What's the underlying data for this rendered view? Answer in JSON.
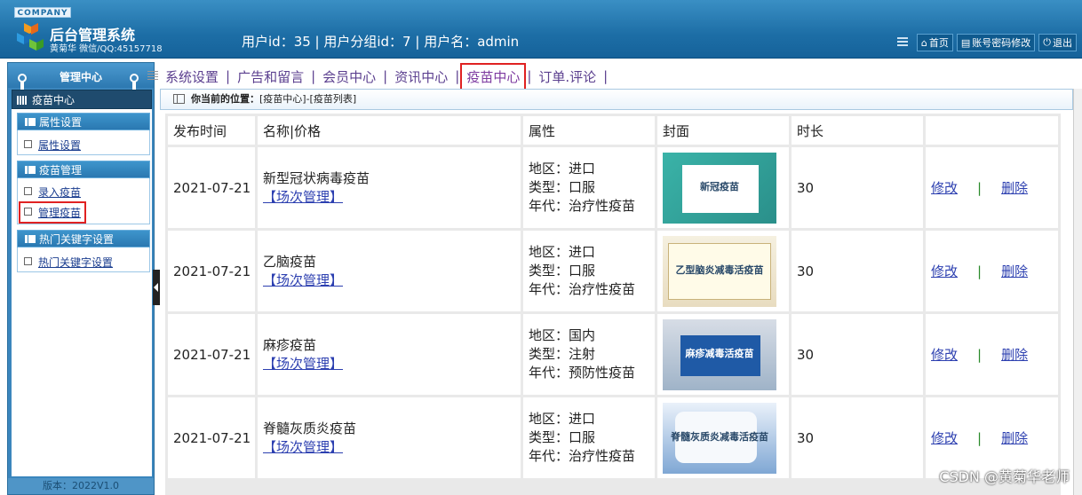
{
  "header": {
    "company": "COMPANY",
    "title": "后台管理系统",
    "subtitle": "黄菊华 微信/QQ:45157718",
    "user_info": "用户id：35 | 用户分组id：7 | 用户名：admin",
    "links": [
      "首页",
      "账号密码修改",
      "退出"
    ]
  },
  "sidebar": {
    "title": "管理中心",
    "current": "疫苗中心",
    "groups": [
      {
        "label": "属性设置",
        "items": [
          "属性设置"
        ]
      },
      {
        "label": "疫苗管理",
        "items": [
          "录入疫苗",
          "管理疫苗"
        ]
      },
      {
        "label": "热门关键字设置",
        "items": [
          "热门关键字设置"
        ]
      }
    ],
    "footer": "版本：2022V1.0"
  },
  "nav": {
    "items": [
      "系统设置",
      "广告和留言",
      "会员中心",
      "资讯中心",
      "疫苗中心",
      "订单.评论"
    ],
    "separator": "|",
    "active": "疫苗中心"
  },
  "breadcrumb": {
    "label": "你当前的位置：",
    "path": "[疫苗中心]-[疫苗列表]"
  },
  "table": {
    "columns": [
      "发布时间",
      "名称|价格",
      "属性",
      "封面",
      "时长",
      ""
    ],
    "attr_labels": [
      "地区：",
      "类型：",
      "年代："
    ],
    "sub_link": "【场次管理】",
    "edit_label": "修改",
    "delete_label": "删除",
    "divider": "|",
    "rows": [
      {
        "date": "2021-07-21",
        "name": "新型冠状病毒疫苗",
        "region": "进口",
        "type": "口服",
        "era": "治疗性疫苗",
        "cover_text": "新冠疫苗",
        "duration": "30"
      },
      {
        "date": "2021-07-21",
        "name": "乙脑疫苗",
        "region": "进口",
        "type": "口服",
        "era": "治疗性疫苗",
        "cover_text": "乙型脑炎减毒活疫苗",
        "duration": "30"
      },
      {
        "date": "2021-07-21",
        "name": "麻疹疫苗",
        "region": "国内",
        "type": "注射",
        "era": "预防性疫苗",
        "cover_text": "麻疹减毒活疫苗",
        "duration": "30"
      },
      {
        "date": "2021-07-21",
        "name": "脊髓灰质炎疫苗",
        "region": "进口",
        "type": "口服",
        "era": "治疗性疫苗",
        "cover_text": "脊髓灰质炎减毒活疫苗",
        "duration": "30"
      }
    ]
  },
  "watermark": "CSDN @黄菊华老师",
  "colors": {
    "accent": "#1d6ea6",
    "highlight": "#e02222",
    "link": "#2c3fb0"
  }
}
